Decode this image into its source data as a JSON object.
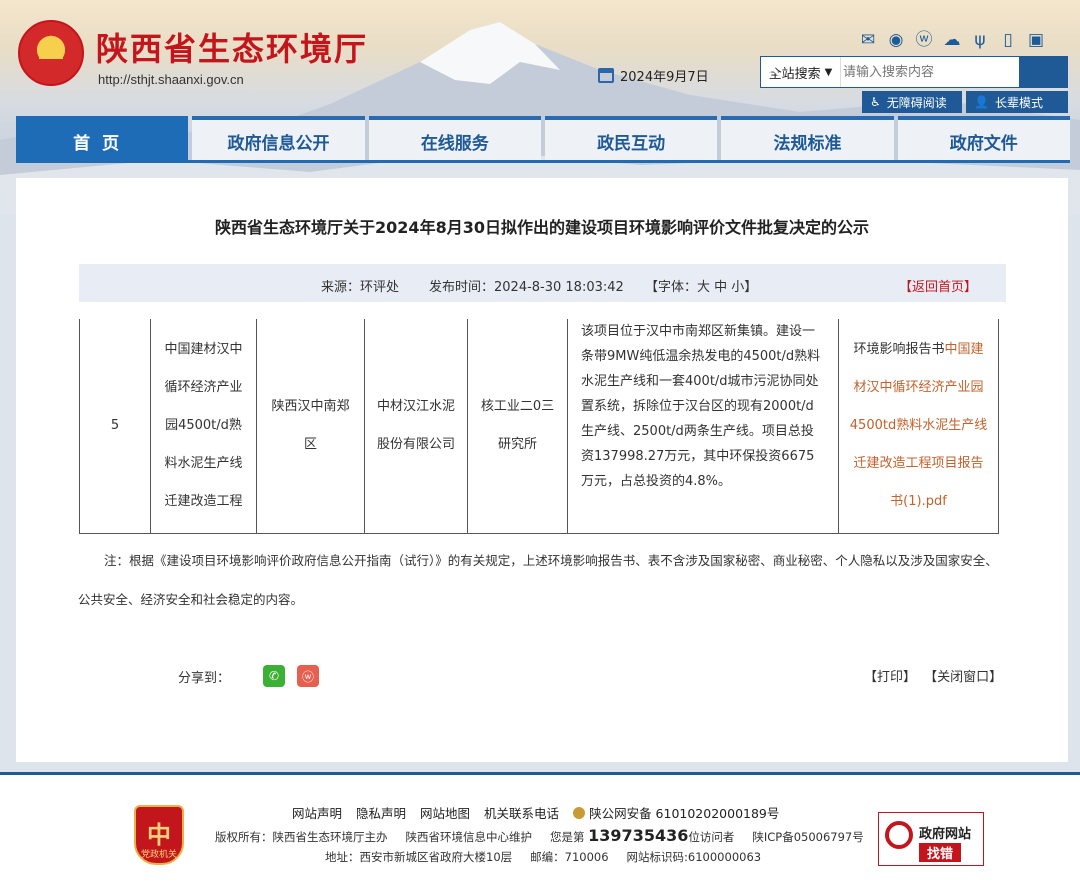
{
  "header": {
    "site_title": "陕西省生态环境厅",
    "site_url": "http://sthjt.shaanxi.gov.cn",
    "date": "2024年9月7日",
    "top_icons": [
      "mail-icon",
      "message-icon",
      "weibo-icon",
      "wechat-icon",
      "toutiao-icon",
      "mobile-icon",
      "app-icon"
    ],
    "search": {
      "scope": "全站搜索",
      "placeholder": "请输入搜索内容"
    },
    "accessibility": {
      "barrier_free": "无障碍阅读",
      "elderly": "长辈模式"
    },
    "colors": {
      "brand_red": "#c3161c",
      "brand_blue": "#1f5a96"
    }
  },
  "nav": {
    "tabs": [
      {
        "label": "首页"
      },
      {
        "label": "政府信息公开"
      },
      {
        "label": "在线服务"
      },
      {
        "label": "政民互动"
      },
      {
        "label": "法规标准"
      },
      {
        "label": "政府文件"
      }
    ]
  },
  "article": {
    "title": "陕西省生态环境厅关于2024年8月30日拟作出的建设项目环境影响评价文件批复决定的公示",
    "meta": {
      "source": "来源：环评处",
      "published": "发布时间：2024-8-30 18:03:42",
      "font_size": "【字体：大 中 小】",
      "back_home": "【返回首页】"
    },
    "row": {
      "index": "5",
      "project": "中国建材汉中循环经济产业园4500t/d熟料水泥生产线迁建改造工程",
      "location": "陕西汉中南郑区",
      "builder": "中材汉江水泥股份有限公司",
      "eia_unit": "核工业二0三研究所",
      "description": "该项目位于汉中市南郑区新集镇。建设一条带9MW纯低温余热发电的4500t/d熟料水泥生产线和一套400t/d城市污泥协同处置系统，拆除位于汉台区的现有2000t/d生产线、2500t/d两条生产线。项目总投资137998.27万元，其中环保投资6675万元，占总投资的4.8%。",
      "file_prefix": "环境影响报告书",
      "file_link": "中国建材汉中循环经济产业园4500td熟料水泥生产线迁建改造工程项目报告书(1).pdf"
    },
    "note": "注：根据《建设项目环境影响评价政府信息公开指南（试行）》的有关规定，上述环境影响报告书、表不含涉及国家秘密、商业秘密、个人隐私以及涉及国家安全、公共安全、经济安全和社会稳定的内容。",
    "share_label": "分享到：",
    "print_label": "【打印】",
    "close_label": "【关闭窗口】"
  },
  "footer": {
    "party_badge": "党政机关",
    "links": [
      "网站声明",
      "隐私声明",
      "网站地图",
      "机关联系电话"
    ],
    "police_record": "陕公网安备 61010202000189号",
    "copyright": "版权所有：陕西省生态环境厅主办",
    "maintainer": "陕西省环境信息中心维护",
    "visitor_prefix": "您是第",
    "visitor_count": "139735436",
    "visitor_suffix": "位访问者",
    "icp": "陕ICP备05006797号",
    "address": "地址：西安市新城区省政府大楼10层",
    "postcode": "邮编：710006",
    "site_id": "网站标识码:6100000063",
    "gov_error_title": "政府网站",
    "gov_error_action": "找错"
  }
}
